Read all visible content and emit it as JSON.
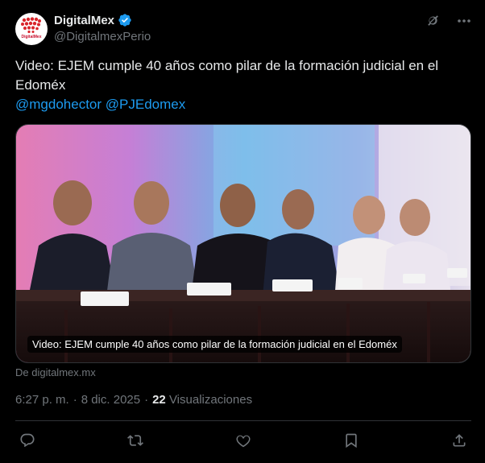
{
  "author": {
    "display_name": "DigitalMex",
    "handle": "@DigitalmexPerio",
    "avatar_logo_text": "DigitalMex"
  },
  "tweet": {
    "text": "Video: EJEM cumple 40 años como pilar de la formación judicial en el Edoméx",
    "mentions": [
      "@mgdohector",
      "@PJEdomex"
    ]
  },
  "media": {
    "caption": "Video: EJEM cumple 40 años como pilar de la formación judicial en el Edoméx",
    "source": "De digitalmex.mx"
  },
  "meta": {
    "time": "6:27 p. m.",
    "separator": "·",
    "date": "8 dic. 2025",
    "views_count": "22",
    "views_label": "Visualizaciones"
  },
  "actions": [
    "reply-icon",
    "repost-icon",
    "like-icon",
    "bookmark-icon",
    "share-icon"
  ],
  "colors": {
    "background": "#000000",
    "text": "#e7e9ea",
    "muted": "#71767b",
    "link": "#1d9bf0",
    "verified": "#1d9bf0",
    "border": "#2f3336"
  }
}
